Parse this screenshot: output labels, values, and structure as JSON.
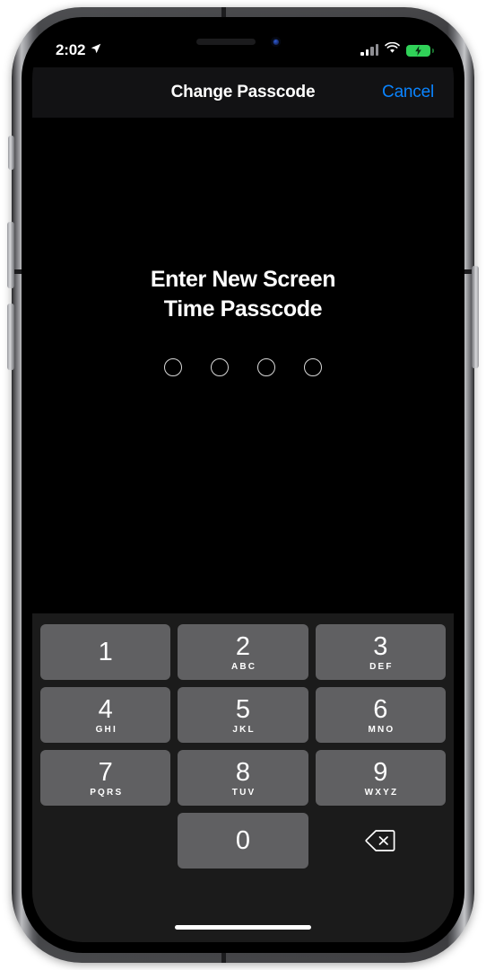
{
  "device": {
    "name": "iphone-frame",
    "side_buttons": [
      "mute-switch",
      "volume-up",
      "volume-down",
      "power"
    ]
  },
  "status_bar": {
    "time": "2:02",
    "location_icon": "location-arrow-icon",
    "signal_icon": "cellular-signal-icon",
    "signal_bars_filled": 2,
    "signal_bars_total": 4,
    "wifi_icon": "wifi-icon",
    "battery_icon": "battery-charging-icon",
    "battery_color": "#30d158",
    "battery_charging": true
  },
  "nav_bar": {
    "title": "Change Passcode",
    "cancel_label": "Cancel",
    "accent_color": "#0a84ff"
  },
  "content": {
    "prompt_line1": "Enter New Screen",
    "prompt_line2": "Time Passcode",
    "passcode_length": 4,
    "digits_entered": 0
  },
  "keypad": {
    "rows": [
      [
        {
          "num": "1",
          "letters": ""
        },
        {
          "num": "2",
          "letters": "ABC"
        },
        {
          "num": "3",
          "letters": "DEF"
        }
      ],
      [
        {
          "num": "4",
          "letters": "GHI"
        },
        {
          "num": "5",
          "letters": "JKL"
        },
        {
          "num": "6",
          "letters": "MNO"
        }
      ],
      [
        {
          "num": "7",
          "letters": "PQRS"
        },
        {
          "num": "8",
          "letters": "TUV"
        },
        {
          "num": "9",
          "letters": "WXYZ"
        }
      ],
      [
        {
          "num": "",
          "letters": ""
        },
        {
          "num": "0",
          "letters": ""
        },
        {
          "num": "delete-icon",
          "letters": ""
        }
      ]
    ],
    "key_color": "#606062",
    "background_color": "#1b1b1b",
    "delete_icon": "backspace-delete-icon"
  },
  "home_indicator": "home-indicator-bar"
}
